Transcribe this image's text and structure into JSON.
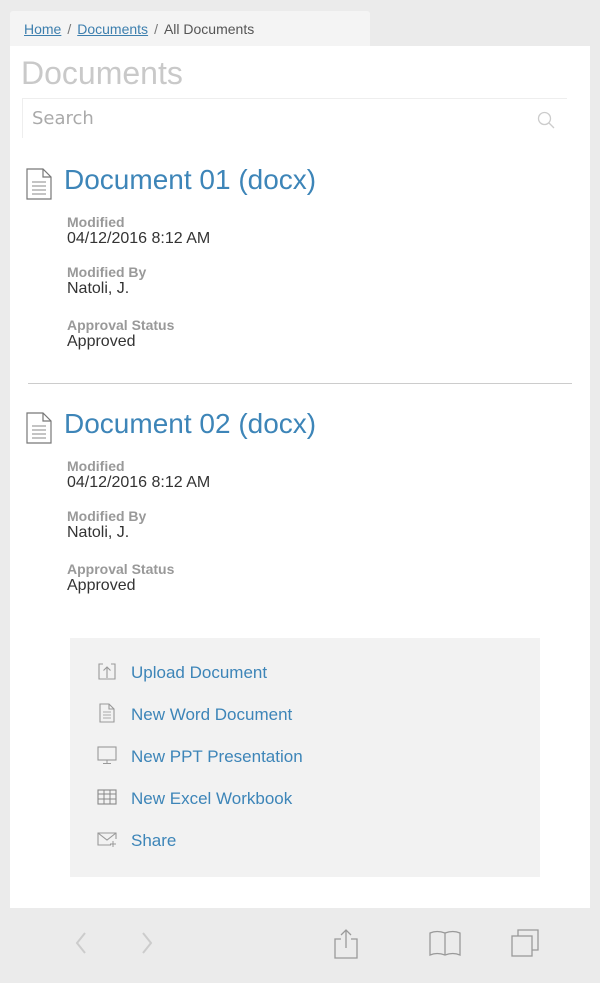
{
  "breadcrumb": {
    "items": [
      {
        "label": "Home",
        "link": true
      },
      {
        "label": "Documents",
        "link": true
      },
      {
        "label": "All Documents",
        "link": false
      }
    ],
    "separator": "/"
  },
  "page": {
    "title": "Documents"
  },
  "search": {
    "placeholder": "Search",
    "value": ""
  },
  "documents": [
    {
      "title": "Document 01 (docx)",
      "icon": "document-icon",
      "fields": [
        {
          "label": "Modified",
          "value": "04/12/2016 8:12 AM"
        },
        {
          "label": "Modified By",
          "value": "Natoli, J."
        },
        {
          "label": "Approval Status",
          "value": "Approved"
        }
      ]
    },
    {
      "title": "Document 02 (docx)",
      "icon": "document-icon",
      "fields": [
        {
          "label": "Modified",
          "value": "04/12/2016 8:12 AM"
        },
        {
          "label": "Modified By",
          "value": "Natoli, J."
        },
        {
          "label": "Approval Status",
          "value": "Approved"
        }
      ]
    }
  ],
  "actions": [
    {
      "label": "Upload Document",
      "icon": "upload-icon"
    },
    {
      "label": "New Word Document",
      "icon": "document-icon"
    },
    {
      "label": "New PPT Presentation",
      "icon": "monitor-icon"
    },
    {
      "label": "New Excel Workbook",
      "icon": "table-icon"
    },
    {
      "label": "Share",
      "icon": "mail-icon"
    }
  ],
  "toolbar": {
    "icons": [
      "back-icon",
      "forward-icon",
      "share-icon",
      "bookmarks-icon",
      "tabs-icon"
    ]
  },
  "colors": {
    "link": "#3d85b8",
    "background": "#ebebeb",
    "panel": "#ffffff",
    "actions_bg": "#f2f2f2"
  }
}
